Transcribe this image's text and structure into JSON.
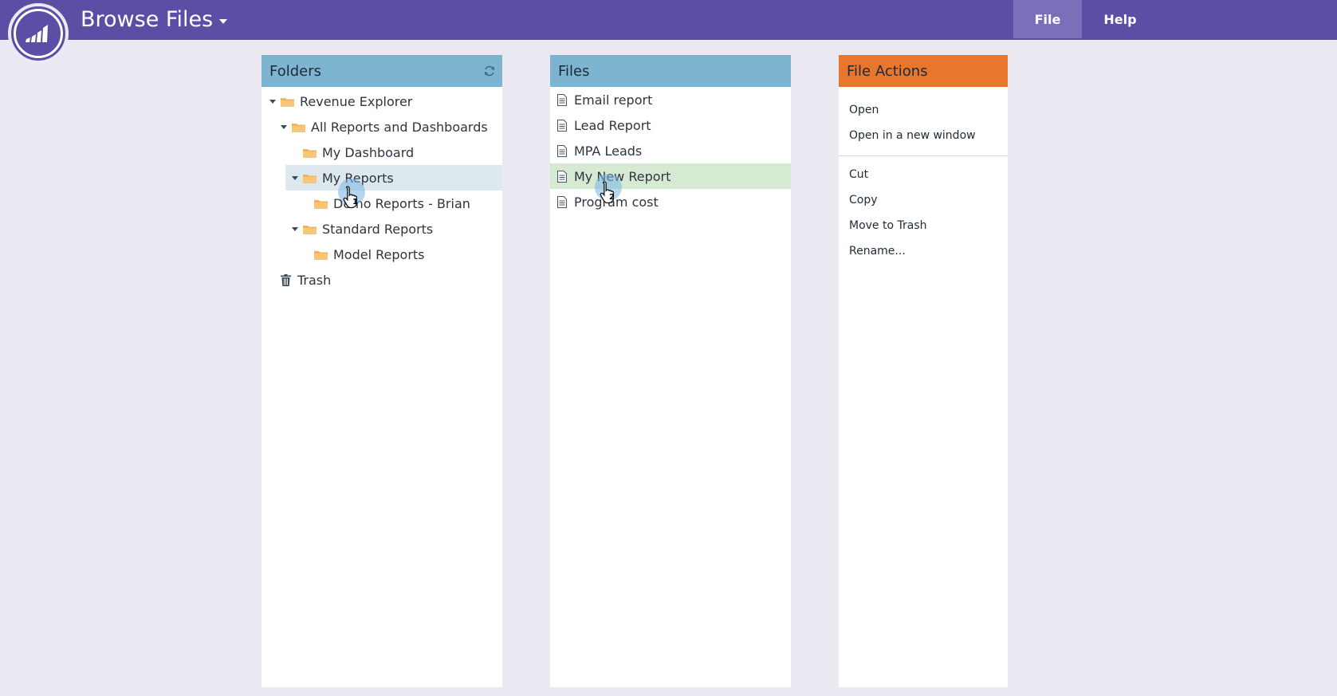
{
  "header": {
    "title": "Browse Files",
    "menu": [
      "File",
      "Help"
    ],
    "colors": {
      "bar": "#5a4fa5",
      "active_menu": "#7a70ba"
    }
  },
  "folders": {
    "title": "Folders",
    "items": [
      {
        "label": "Revenue Explorer",
        "level": 0,
        "expanded": true,
        "icon": "folder-icon"
      },
      {
        "label": "All Reports and Dashboards",
        "level": 1,
        "expanded": true,
        "icon": "folder-icon"
      },
      {
        "label": "My Dashboard",
        "level": 2,
        "expanded": false,
        "icon": "folder-icon"
      },
      {
        "label": "My Reports",
        "level": 2,
        "expanded": true,
        "icon": "folder-icon",
        "selected": true
      },
      {
        "label": "Demo Reports - Brian",
        "level": 3,
        "expanded": false,
        "icon": "folder-icon"
      },
      {
        "label": "Standard Reports",
        "level": 2,
        "expanded": true,
        "icon": "folder-icon"
      },
      {
        "label": "Model Reports",
        "level": 3,
        "expanded": false,
        "icon": "folder-icon"
      },
      {
        "label": "Trash",
        "level": 0,
        "expanded": false,
        "icon": "trash-icon"
      }
    ]
  },
  "files": {
    "title": "Files",
    "items": [
      {
        "label": "Email report"
      },
      {
        "label": "Lead Report"
      },
      {
        "label": "MPA Leads"
      },
      {
        "label": "My New Report",
        "selected": true
      },
      {
        "label": "Program cost"
      }
    ]
  },
  "file_actions": {
    "title": "File Actions",
    "group1": [
      "Open",
      "Open in a new window"
    ],
    "group2": [
      "Cut",
      "Copy",
      "Move to Trash",
      "Rename..."
    ]
  },
  "cursors": [
    {
      "step": "1"
    },
    {
      "step": "2"
    }
  ]
}
